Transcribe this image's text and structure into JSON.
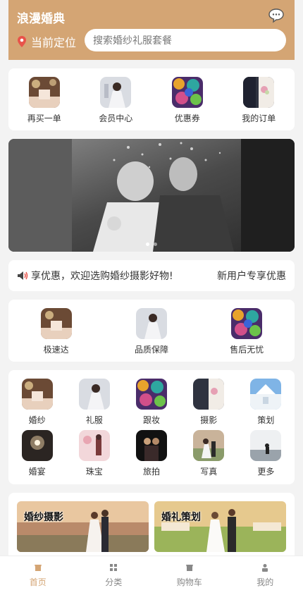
{
  "header": {
    "title": "浪漫婚典",
    "location_label": "当前定位",
    "search_placeholder": "搜索婚纱礼服套餐",
    "accent": "#d4a574"
  },
  "quick_links": [
    {
      "label": "再买一单",
      "icon": "reorder-icon"
    },
    {
      "label": "会员中心",
      "icon": "member-icon"
    },
    {
      "label": "优惠券",
      "icon": "coupon-icon"
    },
    {
      "label": "我的订单",
      "icon": "orders-icon"
    }
  ],
  "banner": {
    "slide_count": 2,
    "active_index": 0
  },
  "notice": {
    "text": "享优惠，欢迎选购婚纱摄影好物!",
    "right_text": "新用户专享优惠"
  },
  "services": [
    {
      "label": "极速达"
    },
    {
      "label": "品质保障"
    },
    {
      "label": "售后无忧"
    }
  ],
  "categories": [
    {
      "label": "婚纱"
    },
    {
      "label": "礼服"
    },
    {
      "label": "跟妆"
    },
    {
      "label": "摄影"
    },
    {
      "label": "策划"
    },
    {
      "label": "婚宴"
    },
    {
      "label": "珠宝"
    },
    {
      "label": "旅拍"
    },
    {
      "label": "写真"
    },
    {
      "label": "更多"
    }
  ],
  "promos": [
    {
      "title": "婚纱摄影"
    },
    {
      "title": "婚礼策划"
    }
  ],
  "tabbar": [
    {
      "label": "首页",
      "icon": "home-icon",
      "active": true
    },
    {
      "label": "分类",
      "icon": "grid-icon",
      "active": false
    },
    {
      "label": "购物车",
      "icon": "cart-icon",
      "active": false
    },
    {
      "label": "我的",
      "icon": "user-icon",
      "active": false
    }
  ]
}
